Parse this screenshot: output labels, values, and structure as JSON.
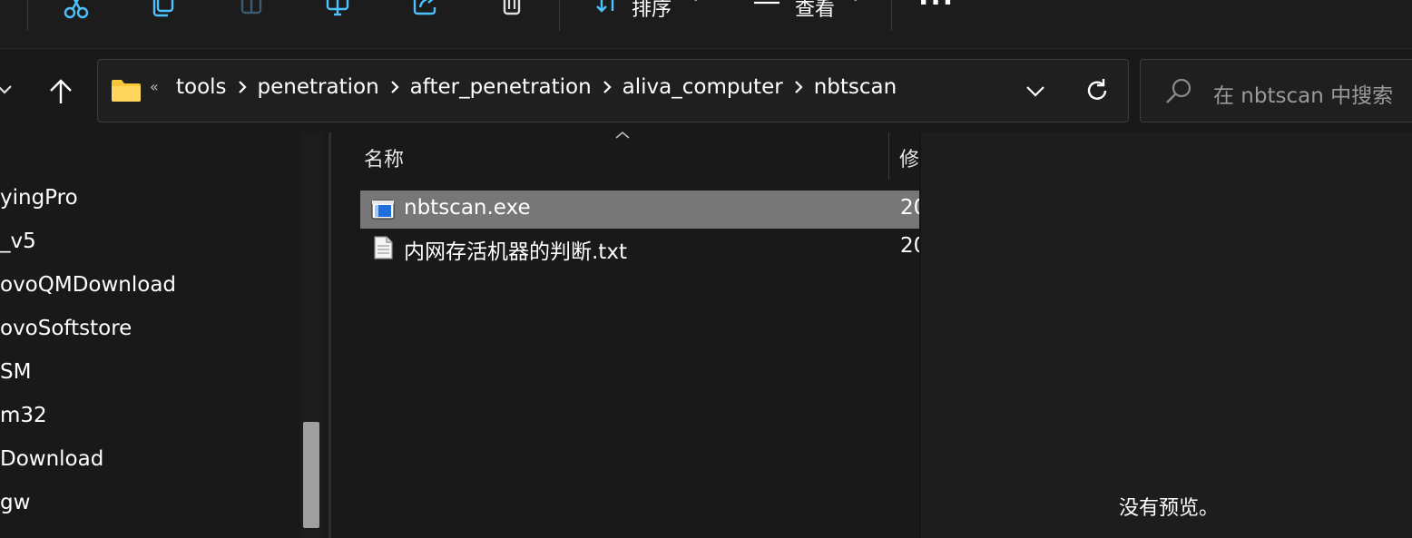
{
  "toolbar": {
    "sort_label": "排序",
    "view_label": "查看",
    "more_label": "..."
  },
  "address": {
    "overflow_glyph": "«",
    "breadcrumbs": [
      "tools",
      "penetration",
      "after_penetration",
      "aliva_computer",
      "nbtscan"
    ]
  },
  "search": {
    "placeholder": "在 nbtscan 中搜索"
  },
  "nav_pane": {
    "items": [
      "yingPro",
      "_v5",
      "ovoQMDownload",
      "ovoSoftstore",
      "SM",
      "m32",
      "Download",
      "gw"
    ]
  },
  "file_list": {
    "columns": {
      "name": "名称",
      "modified": "修"
    },
    "files": [
      {
        "name": "nbtscan.exe",
        "date": "20",
        "icon": "exe-file-icon",
        "selected": true
      },
      {
        "name": "内网存活机器的判断.txt",
        "date": "20",
        "icon": "text-file-icon",
        "selected": false
      }
    ]
  },
  "preview": {
    "message": "没有预览。"
  },
  "colors": {
    "background": "#191919",
    "selected_row": "#777777",
    "accent_blue": "#4cc2ff",
    "folder_yellow": "#f8c739"
  }
}
